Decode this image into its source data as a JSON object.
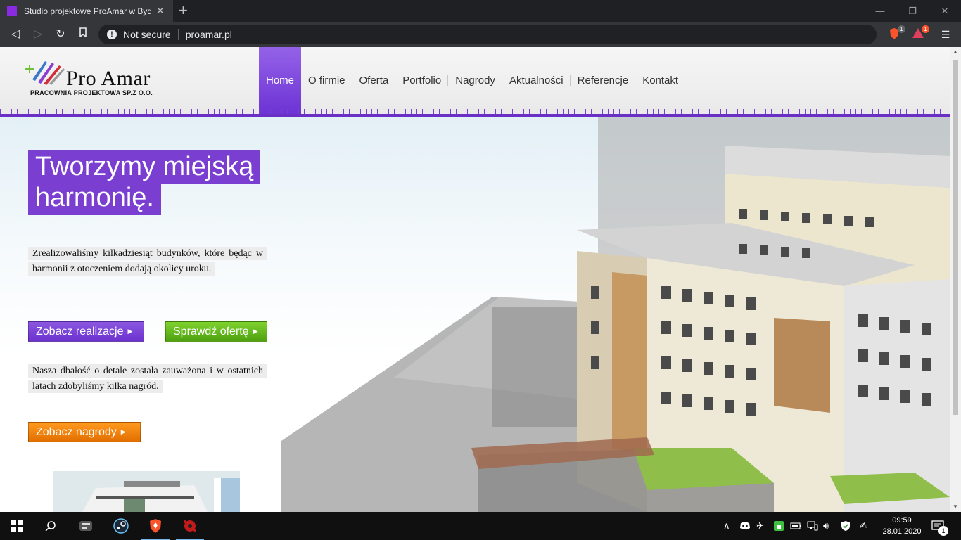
{
  "browser": {
    "tab_title": "Studio projektowe ProAmar w Byd",
    "new_tab": "+",
    "security": "Not secure",
    "url": "proamar.pl",
    "brave_badge": "1",
    "rewards_badge": "1"
  },
  "site": {
    "logo_name": "Pro Amar",
    "logo_sub": "PRACOWNIA PROJEKTOWA  SP.Z O.O.",
    "nav": [
      "Home",
      "O firmie",
      "Oferta",
      "Portfolio",
      "Nagrody",
      "Aktualności",
      "Referencje",
      "Kontakt"
    ],
    "headline_line1": "Tworzymy miejską",
    "headline_line2": "harmonię.",
    "para1": "Zrealizowaliśmy kilkadziesiąt budynków, które będąc w harmonii z otoczeniem dodają okolicy uroku.",
    "btn_realizacje": "Zobacz realizacje",
    "btn_oferta": "Sprawdź ofertę",
    "para2": "Nasza dbałość o detale została zauważona i w ostatnich latach zdobyliśmy kilka nagród.",
    "btn_nagrody": "Zobacz nagrody"
  },
  "taskbar": {
    "time": "09:59",
    "date": "28.01.2020",
    "notifications": "1"
  },
  "colors": {
    "brand_purple": "#7a3fd1",
    "green": "#5cb018",
    "orange": "#f08400"
  }
}
